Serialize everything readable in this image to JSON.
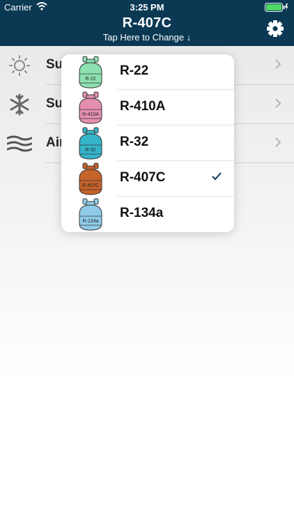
{
  "status": {
    "carrier": "Carrier",
    "time": "3:25 PM"
  },
  "header": {
    "title": "R-407C",
    "subtitle": "Tap Here to Change ↓"
  },
  "menu": [
    {
      "label": "Su",
      "icon": "sun-icon"
    },
    {
      "label": "Su",
      "icon": "snowflake-icon"
    },
    {
      "label": "Air",
      "icon": "airflow-icon"
    }
  ],
  "refrigerants": [
    {
      "name": "R-22",
      "tank_label": "R-22",
      "color": "#8de0b0",
      "selected": false
    },
    {
      "name": "R-410A",
      "tank_label": "R-410A",
      "color": "#e48fb0",
      "selected": false
    },
    {
      "name": "R-32",
      "tank_label": "R-32",
      "color": "#36b4c9",
      "selected": false
    },
    {
      "name": "R-407C",
      "tank_label": "R-407C",
      "color": "#c6632a",
      "selected": true
    },
    {
      "name": "R-134a",
      "tank_label": "R-134a",
      "color": "#8fcbe8",
      "selected": false
    }
  ],
  "colors": {
    "nav": "#0b3954",
    "check": "#0b3954"
  }
}
